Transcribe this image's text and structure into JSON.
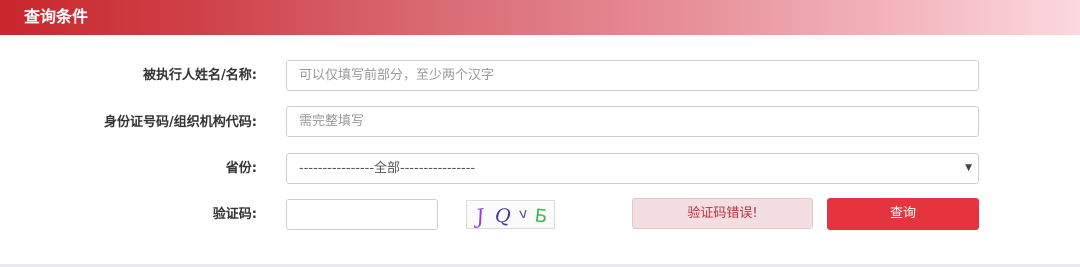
{
  "header": {
    "title": "查询条件"
  },
  "form": {
    "name": {
      "label": "被执行人姓名/名称:",
      "placeholder": "可以仅填写前部分，至少两个汉字"
    },
    "id_code": {
      "label": "身份证号码/组织机构代码:",
      "placeholder": "需完整填写"
    },
    "province": {
      "label": "省份:",
      "selected": "----------------全部----------------"
    },
    "captcha": {
      "label": "验证码:",
      "value": "",
      "image_text": [
        "J",
        "Q",
        "v",
        "Б"
      ],
      "image_colors": [
        "#9b3bd6",
        "#3a3aa8",
        "#5a4bb0",
        "#3cb84a"
      ],
      "error_text": "验证码错误!"
    },
    "submit_label": "查询"
  },
  "colors": {
    "header_start": "#c9262e",
    "header_end": "#fbd9de",
    "button": "#e6343e",
    "error_bg": "#f3dfe1"
  }
}
